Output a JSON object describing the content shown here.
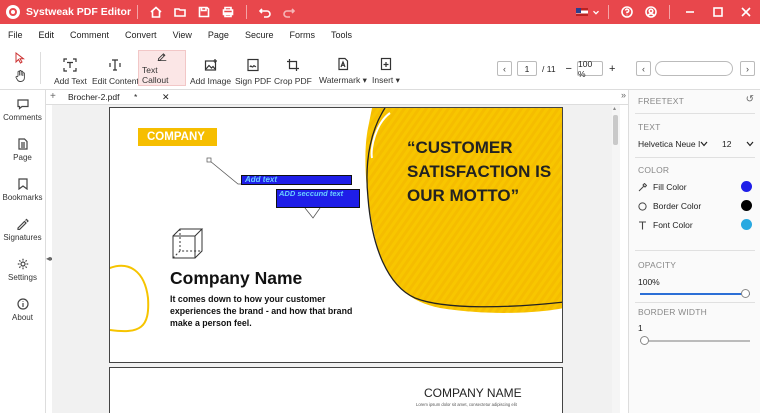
{
  "app": {
    "title": "Systweak PDF Editor"
  },
  "menu": [
    "File",
    "Edit",
    "Comment",
    "Convert",
    "View",
    "Page",
    "Secure",
    "Forms",
    "Tools"
  ],
  "ribbon": {
    "buttons": [
      "Add Text",
      "Edit Content",
      "Text Callout",
      "Add Image",
      "Sign PDF",
      "Crop PDF",
      "Watermark",
      "Insert"
    ]
  },
  "pager": {
    "current": "1",
    "total": "/ 11",
    "zoom": "100 %"
  },
  "leftnav": [
    "Comments",
    "Page",
    "Bookmarks",
    "Signatures",
    "Settings",
    "About"
  ],
  "tab": {
    "name": "Brocher-2.pdf",
    "modified": "*"
  },
  "page": {
    "company_tag": "COMPANY",
    "callout1": "Add text",
    "callout2": "ADD seccund text",
    "slogan": [
      "“CUSTOMER",
      "SATISFACTION IS",
      "OUR MOTTO”"
    ],
    "company_name": "Company Name",
    "tagline": [
      "It comes down to how your customer",
      "experiences the brand - and how that brand",
      "make a person feel."
    ],
    "page2_title": "COMPANY NAME",
    "page2_sub": "Lorem ipsum dolor sit amet, consectetur adipiscing elit"
  },
  "panel": {
    "title": "FREETEXT",
    "text_header": "TEXT",
    "font": "Helvetica Neue I",
    "size": "12",
    "color_header": "COLOR",
    "fill_label": "Fill Color",
    "border_label": "Border Color",
    "fontcolor_label": "Font Color",
    "opacity_header": "OPACITY",
    "opacity_value": "100%",
    "opacity_level": 1.0,
    "borderwidth_header": "BORDER WIDTH",
    "borderwidth_value": "1",
    "borderwidth_level": 0.0
  },
  "colors": {
    "accent": "#e8474c",
    "fill": "#1f1ee8",
    "border": "#000000",
    "font": "#29a9e1",
    "yellow": "#f7c300"
  }
}
